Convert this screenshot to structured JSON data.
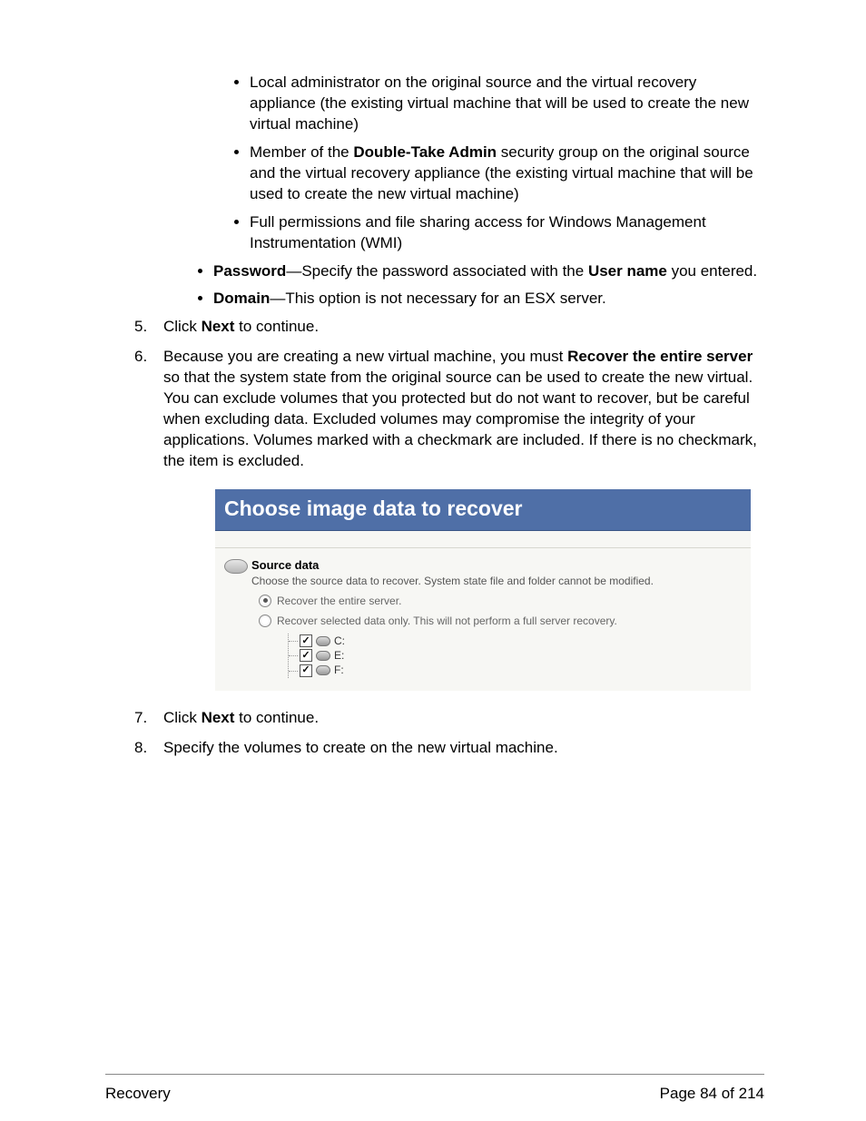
{
  "bullets_inner": [
    {
      "text": "Local administrator on the original source and the virtual recovery appliance (the existing virtual machine that will be used to create the new virtual machine)"
    },
    {
      "pre": "Member of the ",
      "bold": "Double-Take Admin",
      "post": " security group on the original source and the virtual recovery appliance (the existing virtual machine that will be used to create the new virtual machine)"
    },
    {
      "text": "Full permissions and file sharing access for Windows Management Instrumentation (WMI)"
    }
  ],
  "bullets_outer": [
    {
      "bold": "Password",
      "post": "—Specify the password associated with the ",
      "bold2": "User name",
      "post2": " you entered."
    },
    {
      "bold": "Domain",
      "post": "—This option is not necessary for an ESX server."
    }
  ],
  "steps": {
    "s5": {
      "num": "5.",
      "pre": "Click ",
      "bold": "Next",
      "post": " to continue."
    },
    "s6": {
      "num": "6.",
      "pre": "Because you are creating a new virtual machine, you must ",
      "bold": "Recover the entire server",
      "post": " so that the system state from the original source can be used to create the new virtual. You can exclude volumes that you protected but do not want to recover, but be careful when excluding data. Excluded volumes may compromise the integrity of your applications. Volumes marked with a checkmark are included. If there is no checkmark, the item is excluded."
    },
    "s7": {
      "num": "7.",
      "pre": "Click ",
      "bold": "Next",
      "post": " to continue."
    },
    "s8": {
      "num": "8.",
      "text": "Specify the volumes to create on the new virtual machine."
    }
  },
  "dialog": {
    "title": "Choose image data to recover",
    "section_title": "Source data",
    "section_desc": "Choose the source data to recover.  System state file and folder cannot be modified.",
    "opt1": "Recover the entire server.",
    "opt2": "Recover selected data only.  This will not perform a full server recovery.",
    "volumes": [
      "C:",
      "E:",
      "F:"
    ]
  },
  "footer": {
    "left": "Recovery",
    "right": "Page 84 of 214"
  }
}
